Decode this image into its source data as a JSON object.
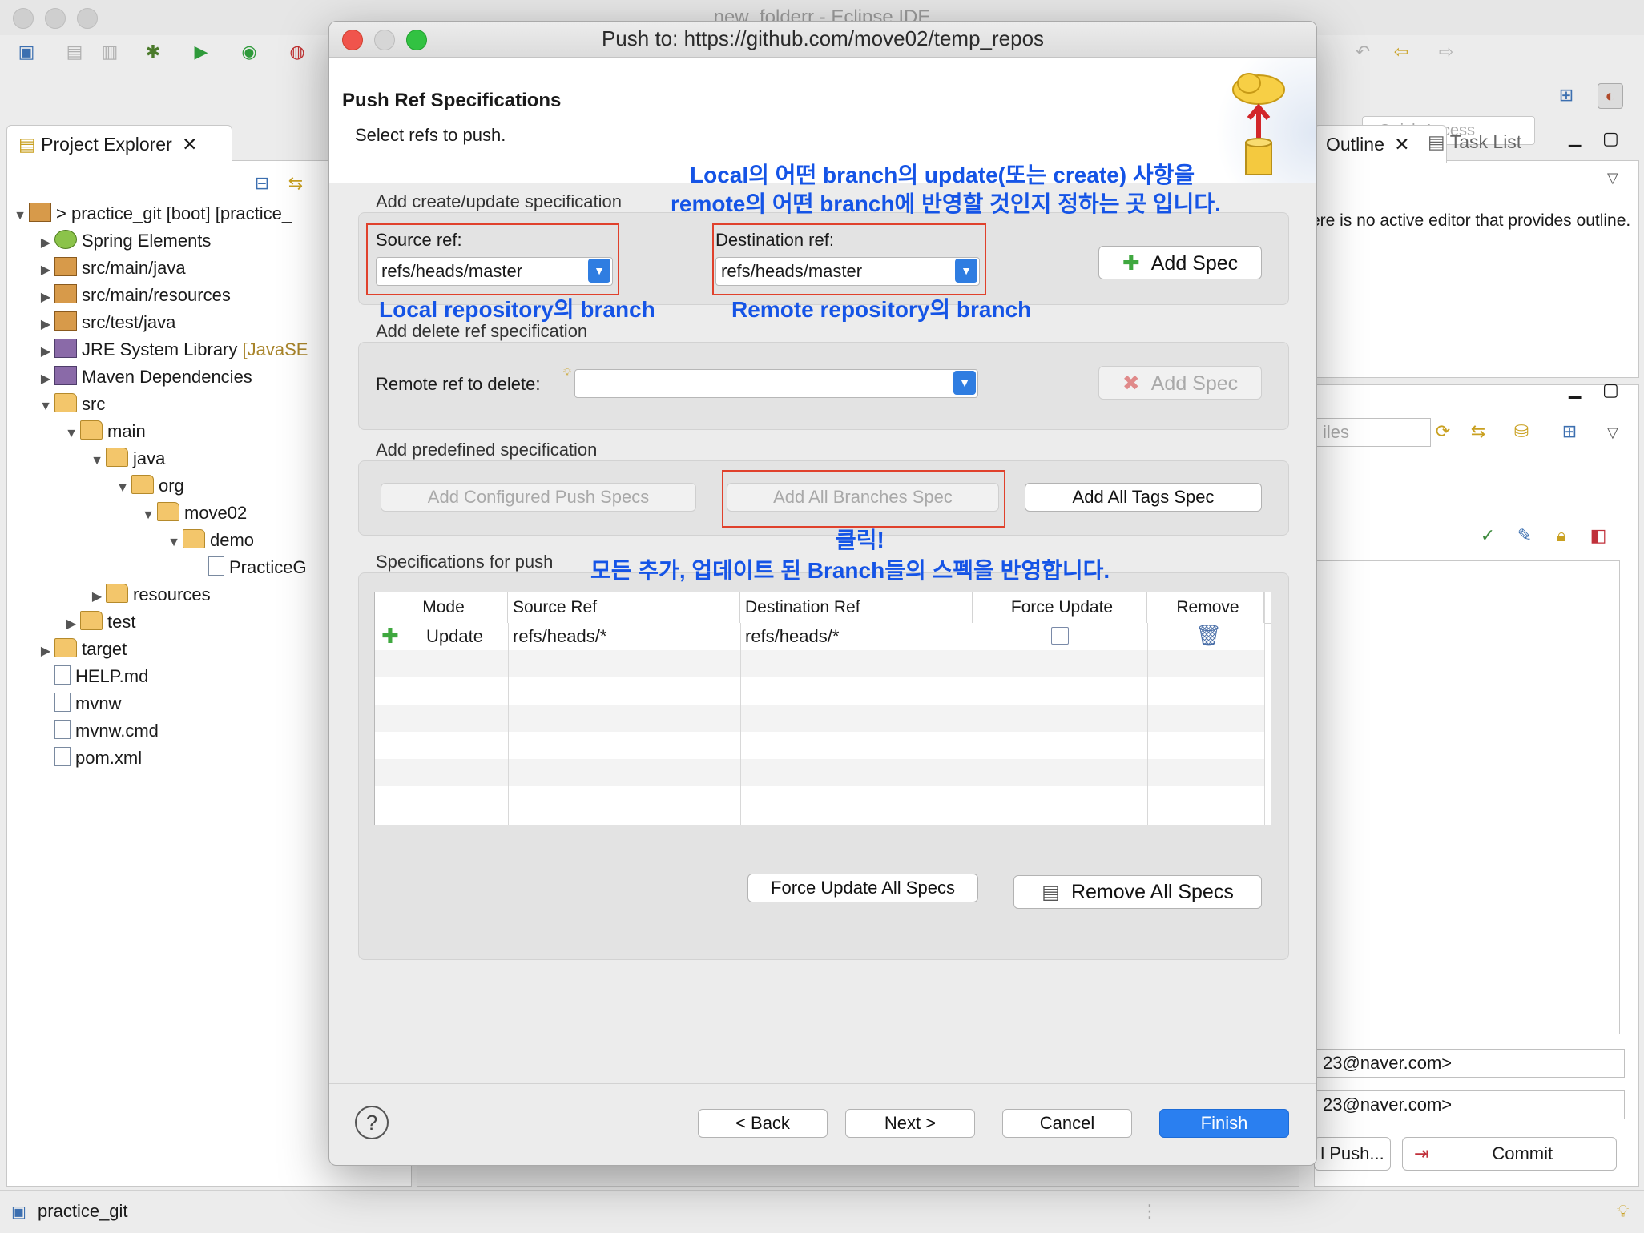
{
  "ide": {
    "title": "new_folderr - Eclipse IDE",
    "quick_access_placeholder": "Quick Access",
    "project_explorer_tab": "Project Explorer",
    "outline_tab": "Outline",
    "task_list_tab": "Task List",
    "outline_message": "ere is no active editor that provides outline.",
    "files_filter_placeholder": "iles",
    "email_1": "23@naver.com>",
    "email_2": "23@naver.com>",
    "push_button": "l Push...",
    "commit_button": "Commit",
    "status_project": "practice_git",
    "tree": [
      {
        "label": "> practice_git [boot] [practice_",
        "depth": 0,
        "twisty": "▼",
        "icon": "project"
      },
      {
        "label": "Spring Elements",
        "depth": 1,
        "twisty": "▶",
        "icon": "spring"
      },
      {
        "label": "src/main/java",
        "depth": 1,
        "twisty": "▶",
        "icon": "pkg"
      },
      {
        "label": "src/main/resources",
        "depth": 1,
        "twisty": "▶",
        "icon": "pkg"
      },
      {
        "label": "src/test/java",
        "depth": 1,
        "twisty": "▶",
        "icon": "pkg"
      },
      {
        "label": "JRE System Library",
        "suffix": " [JavaSE",
        "depth": 1,
        "twisty": "▶",
        "icon": "jar"
      },
      {
        "label": "Maven Dependencies",
        "depth": 1,
        "twisty": "▶",
        "icon": "jar"
      },
      {
        "label": "src",
        "depth": 1,
        "twisty": "▼",
        "icon": "folder"
      },
      {
        "label": "main",
        "depth": 2,
        "twisty": "▼",
        "icon": "folder"
      },
      {
        "label": "java",
        "depth": 3,
        "twisty": "▼",
        "icon": "folder"
      },
      {
        "label": "org",
        "depth": 4,
        "twisty": "▼",
        "icon": "folder"
      },
      {
        "label": "move02",
        "depth": 5,
        "twisty": "▼",
        "icon": "folder"
      },
      {
        "label": "demo",
        "depth": 6,
        "twisty": "▼",
        "icon": "folder"
      },
      {
        "label": "PracticeG",
        "depth": 7,
        "twisty": "",
        "icon": "file"
      },
      {
        "label": "resources",
        "depth": 3,
        "twisty": "▶",
        "icon": "folder"
      },
      {
        "label": "test",
        "depth": 2,
        "twisty": "▶",
        "icon": "folder"
      },
      {
        "label": "target",
        "depth": 1,
        "twisty": "▶",
        "icon": "folder"
      },
      {
        "label": "HELP.md",
        "depth": 1,
        "twisty": "",
        "icon": "file"
      },
      {
        "label": "mvnw",
        "depth": 1,
        "twisty": "",
        "icon": "file"
      },
      {
        "label": "mvnw.cmd",
        "depth": 1,
        "twisty": "",
        "icon": "file"
      },
      {
        "label": "pom.xml",
        "depth": 1,
        "twisty": "",
        "icon": "file"
      }
    ]
  },
  "dialog": {
    "title": "Push to: https://github.com/move02/temp_repos",
    "heading": "Push Ref Specifications",
    "subheading": "Select refs to push.",
    "create_update": {
      "group_label": "Add create/update specification",
      "source_label": "Source ref:",
      "source_value": "refs/heads/master",
      "destination_label": "Destination ref:",
      "destination_value": "refs/heads/master",
      "add_spec": "Add Spec"
    },
    "delete": {
      "group_label": "Add delete ref specification",
      "remote_label": "Remote ref to delete:",
      "remote_value": "",
      "add_spec": "Add Spec"
    },
    "predefined": {
      "group_label": "Add predefined specification",
      "configured": "Add Configured Push Specs",
      "all_branches": "Add All Branches Spec",
      "all_tags": "Add All Tags Spec"
    },
    "specs": {
      "group_label": "Specifications for push",
      "columns": [
        "Mode",
        "Source Ref",
        "Destination Ref",
        "Force Update",
        "Remove"
      ],
      "rows": [
        {
          "mode": "Update",
          "source": "refs/heads/*",
          "destination": "refs/heads/*",
          "force": false
        }
      ],
      "force_update_all": "Force Update All Specs",
      "remove_all": "Remove All Specs"
    },
    "buttons": {
      "back": "< Back",
      "next": "Next >",
      "cancel": "Cancel",
      "finish": "Finish"
    }
  },
  "annotations": {
    "top_line1": "Local의 어떤 branch의 update(또는 create) 사항을",
    "top_line2": "remote의 어떤 branch에 반영할 것인지 정하는 곳 입니다.",
    "local_branch": "Local repository의 branch",
    "remote_branch": "Remote repository의 branch",
    "click": "클릭!",
    "all_specs": "모든 추가, 업데이트 된 Branch들의 스펙을 반영합니다."
  },
  "colors": {
    "annotation": "#1554e6",
    "highlight_box": "#e0412c",
    "primary_button": "#2a7ff0"
  }
}
